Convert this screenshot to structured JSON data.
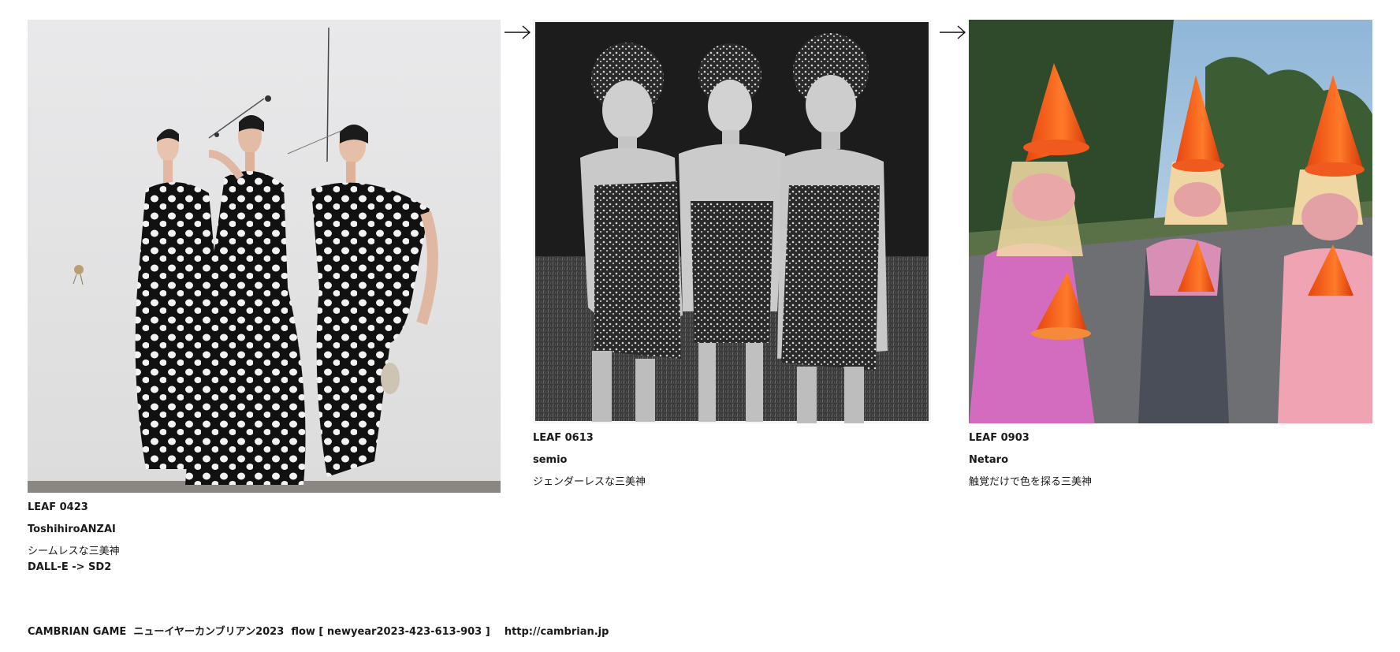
{
  "leaves": [
    {
      "leaf_id": "LEAF 0423",
      "author": "ToshihiroANZAI",
      "title": "シームレスな三美神",
      "note": "DALL-E -> SD2"
    },
    {
      "leaf_id": "LEAF 0613",
      "author": "semio",
      "title": "ジェンダーレスな三美神"
    },
    {
      "leaf_id": "LEAF 0903",
      "author": "Netaro",
      "title": "触覚だけで色を探る三美神"
    }
  ],
  "footer": {
    "brand": "CAMBRIAN GAME",
    "event": "ニューイヤーカンブリアン2023",
    "flow": "flow [ newyear2023-423-613-903 ]",
    "url": "http://cambrian.jp"
  },
  "colors": {
    "text": "#1a1a1a",
    "background": "#ffffff",
    "cone_orange": "#f05a1e"
  },
  "icons": {
    "arrow": "right-arrow-icon"
  }
}
